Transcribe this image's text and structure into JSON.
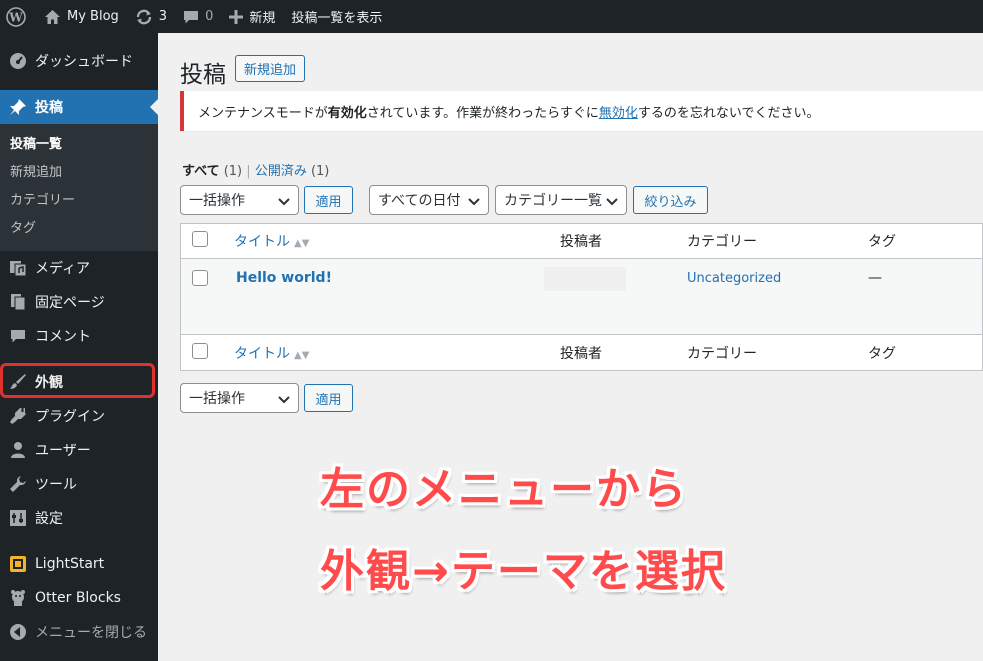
{
  "admin_bar": {
    "site_name": "My Blog",
    "updates_count": "3",
    "comments_count": "0",
    "new_label": "新規",
    "view_posts_label": "投稿一覧を表示"
  },
  "sidebar": {
    "items": [
      {
        "label": "ダッシュボード",
        "icon": "dashboard-icon"
      },
      {
        "label": "投稿",
        "icon": "pin-icon",
        "current": true
      },
      {
        "label": "メディア",
        "icon": "media-icon"
      },
      {
        "label": "固定ページ",
        "icon": "page-icon"
      },
      {
        "label": "コメント",
        "icon": "comment-icon"
      },
      {
        "label": "外観",
        "icon": "brush-icon",
        "highlighted": true
      },
      {
        "label": "プラグイン",
        "icon": "plugin-icon"
      },
      {
        "label": "ユーザー",
        "icon": "user-icon"
      },
      {
        "label": "ツール",
        "icon": "wrench-icon"
      },
      {
        "label": "設定",
        "icon": "settings-icon"
      },
      {
        "label": "LightStart",
        "icon": "lightstart-icon"
      },
      {
        "label": "Otter Blocks",
        "icon": "otter-icon"
      },
      {
        "label": "メニューを閉じる",
        "icon": "collapse-icon"
      }
    ],
    "submenu": [
      "投稿一覧",
      "新規追加",
      "カテゴリー",
      "タグ"
    ]
  },
  "page": {
    "title": "投稿",
    "add_new": "新規追加"
  },
  "notice": {
    "text_before": "メンテナンスモードが",
    "bold": "有効化",
    "text_middle": "されています。作業が終わったらすぐに",
    "link": "無効化",
    "text_after": "するのを忘れないでください。"
  },
  "filters": {
    "all_label": "すべて",
    "all_count": "(1)",
    "separator": "|",
    "published_label": "公開済み",
    "published_count": "(1)"
  },
  "tablenav": {
    "bulk_action": "一括操作",
    "apply": "適用",
    "all_dates": "すべての日付",
    "category_list": "カテゴリー一覧",
    "filter": "絞り込み"
  },
  "table": {
    "columns": [
      "タイトル",
      "投稿者",
      "カテゴリー",
      "タグ"
    ],
    "rows": [
      {
        "title": "Hello world!",
        "author": "",
        "category": "Uncategorized",
        "tags": "—"
      }
    ]
  },
  "annotation": {
    "line1": "左のメニューから",
    "line2": "外観→テーマを選択",
    "color": "#ff4b4b"
  },
  "colors": {
    "admin_bar": "#1d2327",
    "accent": "#2271b1",
    "notice_border": "#d63638",
    "highlight": "#e0322c"
  }
}
